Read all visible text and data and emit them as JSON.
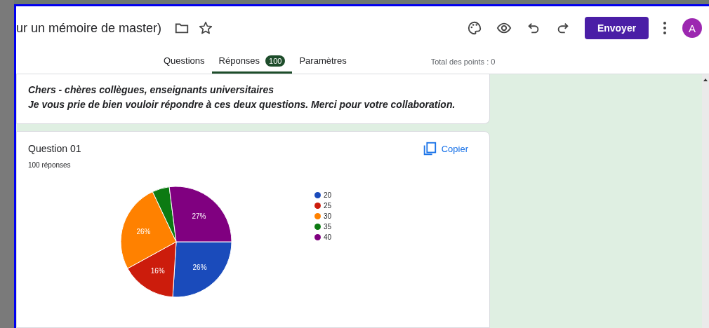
{
  "header": {
    "title": "ur un mémoire de master)",
    "send_button": "Envoyer",
    "avatar": "A"
  },
  "tabs": [
    {
      "label": "Questions",
      "selected": false
    },
    {
      "label": "Réponses",
      "selected": true,
      "badge": "100"
    },
    {
      "label": "Paramètres",
      "selected": false
    }
  ],
  "total_points": "Total des points : 0",
  "intro": {
    "lines": [
      "Chers - chères collègues, enseignants universitaires",
      "Je vous prie de bien vouloir répondre à ces deux questions. Merci pour votre collaboration."
    ]
  },
  "question": {
    "title": "Question 01",
    "count": "100 réponses",
    "copy_button": "Copier",
    "chart_data": {
      "type": "pie",
      "categories": [
        "20",
        "25",
        "30",
        "35",
        "40"
      ],
      "series": [
        {
          "values": [
            26,
            16,
            26,
            5,
            27
          ]
        }
      ],
      "colors": [
        "#1a4bbb",
        "#cc1c0c",
        "#ff8100",
        "#0c7a12",
        "#800080"
      ],
      "value_labels": [
        "26%",
        "16%",
        "26%",
        null,
        "27%"
      ],
      "legend": "right"
    }
  }
}
